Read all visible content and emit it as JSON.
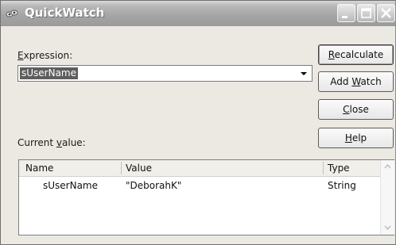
{
  "window": {
    "title": "QuickWatch"
  },
  "expression": {
    "label_pre": "",
    "label_key": "E",
    "label_post": "xpression:",
    "value": "sUserName"
  },
  "buttons": {
    "recalculate": {
      "pre": "",
      "key": "R",
      "post": "ecalculate"
    },
    "add_watch": {
      "pre": "Add ",
      "key": "W",
      "post": "atch"
    },
    "close": {
      "pre": "",
      "key": "C",
      "post": "lose"
    },
    "help": {
      "pre": "",
      "key": "H",
      "post": "elp"
    }
  },
  "current_value": {
    "label_pre": "Current ",
    "label_key": "v",
    "label_post": "alue:"
  },
  "grid": {
    "columns": [
      "Name",
      "Value",
      "Type"
    ],
    "rows": [
      {
        "name": "sUserName",
        "value": "\"DeborahK\"",
        "type": "String"
      }
    ]
  },
  "colors": {
    "title_bar": "#a4a4a4",
    "dialog_bg": "#ece9e3",
    "selection": "#5e5e5e"
  },
  "icons": [
    "quickwatch-app-icon",
    "minimize-icon",
    "maximize-icon",
    "close-icon",
    "dropdown-arrow-icon",
    "scroll-up-icon",
    "scroll-down-icon"
  ]
}
